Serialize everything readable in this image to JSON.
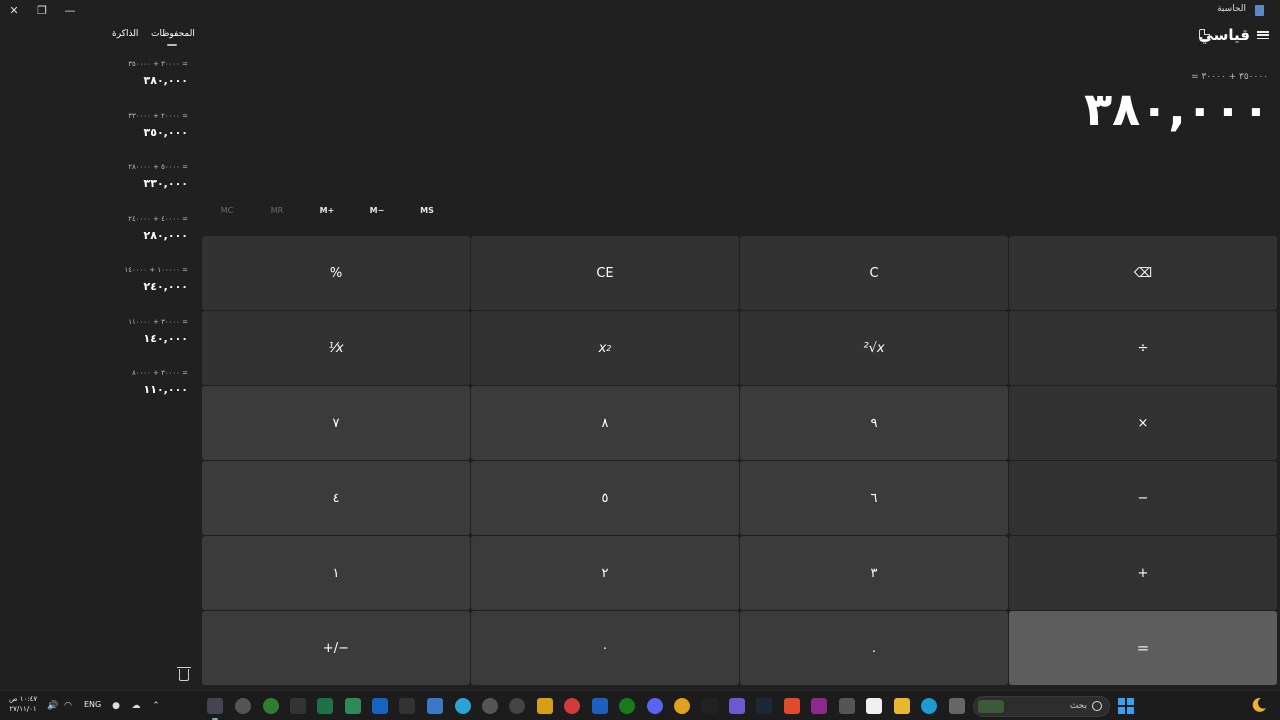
{
  "window": {
    "title": "الحاسبة",
    "close_label": "✕",
    "maximize_label": "❐",
    "minimize_label": "—"
  },
  "header": {
    "mode_title": "قياسي"
  },
  "display": {
    "expression": "= ٣٥٠٠٠٠ + ٣٠٠٠٠",
    "value": "٣٨٠,٠٠٠"
  },
  "memory": {
    "mc": "MC",
    "mr": "MR",
    "m_plus": "M+",
    "m_minus": "M−",
    "ms": "MS"
  },
  "keys": {
    "percent": "%",
    "ce": "CE",
    "c": "C",
    "backspace": "⌫",
    "reciprocal": "⅟x",
    "square_base": "x",
    "square_exp": "2",
    "sqrt": "²√x",
    "divide": "÷",
    "seven": "٧",
    "eight": "٨",
    "nine": "٩",
    "multiply": "×",
    "four": "٤",
    "five": "٥",
    "six": "٦",
    "minus": "−",
    "one": "١",
    "two": "٢",
    "three": "٣",
    "plus": "+",
    "negate": "+/−",
    "zero": "٠",
    "decimal": ".",
    "equals": "="
  },
  "history_panel": {
    "tab_history": "المحفوظات",
    "tab_memory": "الذاكرة",
    "items": [
      {
        "expression": "٣٠٠٠٠ + ٣٥٠٠٠٠ =",
        "result": "٣٨٠,٠٠٠"
      },
      {
        "expression": "٢٠٠٠٠ + ٣٣٠٠٠٠ =",
        "result": "٣٥٠,٠٠٠"
      },
      {
        "expression": "٥٠٠٠٠ + ٢٨٠٠٠٠ =",
        "result": "٣٣٠,٠٠٠"
      },
      {
        "expression": "٤٠٠٠٠ + ٢٤٠٠٠٠ =",
        "result": "٢٨٠,٠٠٠"
      },
      {
        "expression": "١٠٠٠٠٠ + ١٤٠٠٠٠ =",
        "result": "٢٤٠,٠٠٠"
      },
      {
        "expression": "٣٠٠٠٠ + ١١٠٠٠٠ =",
        "result": "١٤٠,٠٠٠"
      },
      {
        "expression": "٣٠٠٠٠ + ٨٠٠٠٠ =",
        "result": "١١٠,٠٠٠"
      }
    ]
  },
  "taskbar": {
    "time": "١٠:٤٧ ص",
    "date": "٢٧/١١/٠١",
    "language": "ENG",
    "search_placeholder": "بحث",
    "colors": {
      "accent": "#3aa0f0",
      "background": "#1c1c1c"
    }
  }
}
